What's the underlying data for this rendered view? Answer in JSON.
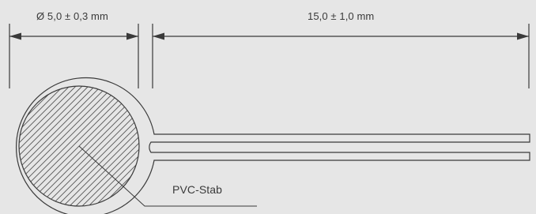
{
  "dimensions": {
    "diameter_label": "Ø 5,0 ± 0,3 mm",
    "length_label": "15,0 ± 1,0 mm"
  },
  "parts": {
    "material_label": "PVC-Stab"
  },
  "colors": {
    "background": "#e6e6e6",
    "line": "#3a3a3a"
  }
}
